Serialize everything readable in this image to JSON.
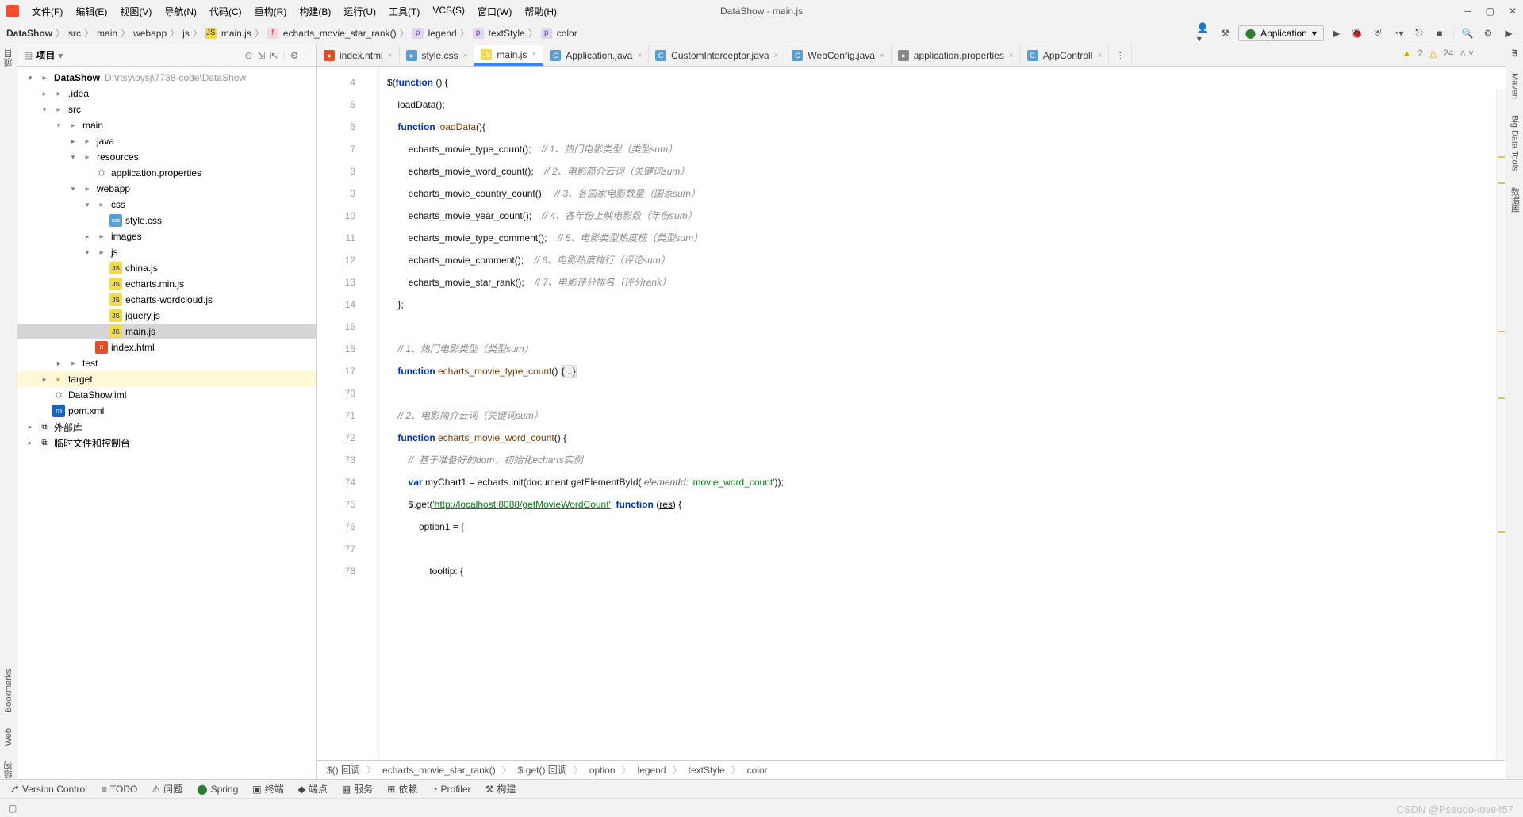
{
  "title": "DataShow - main.js",
  "menus": [
    "文件(F)",
    "编辑(E)",
    "视图(V)",
    "导航(N)",
    "代码(C)",
    "重构(R)",
    "构建(B)",
    "运行(U)",
    "工具(T)",
    "VCS(S)",
    "窗口(W)",
    "帮助(H)"
  ],
  "breadcrumb": {
    "parts": [
      "DataShow",
      "src",
      "main",
      "webapp",
      "js"
    ],
    "file": "main.js",
    "sym1": "echarts_movie_star_rank()",
    "sym2": "legend",
    "sym3": "textStyle",
    "sym4": "color"
  },
  "runconfig": "Application",
  "project": {
    "title": "项目",
    "root": {
      "name": "DataShow",
      "path": "D:\\rtsy\\bysj\\7738-code\\DataShow"
    },
    "tree": [
      {
        "indent": 0,
        "arrow": "▾",
        "icon": "folder",
        "name": "DataShow",
        "path": "D:\\rtsy\\bysj\\7738-code\\DataShow",
        "bold": true
      },
      {
        "indent": 1,
        "arrow": "▸",
        "icon": "folder",
        "name": ".idea"
      },
      {
        "indent": 1,
        "arrow": "▾",
        "icon": "folder",
        "name": "src"
      },
      {
        "indent": 2,
        "arrow": "▾",
        "icon": "folder",
        "name": "main"
      },
      {
        "indent": 3,
        "arrow": "▸",
        "icon": "folder",
        "name": "java"
      },
      {
        "indent": 3,
        "arrow": "▾",
        "icon": "folder",
        "name": "resources"
      },
      {
        "indent": 4,
        "arrow": "",
        "icon": "prop",
        "name": "application.properties"
      },
      {
        "indent": 3,
        "arrow": "▾",
        "icon": "folder",
        "name": "webapp"
      },
      {
        "indent": 4,
        "arrow": "▾",
        "icon": "folder",
        "name": "css"
      },
      {
        "indent": 5,
        "arrow": "",
        "icon": "css",
        "name": "style.css"
      },
      {
        "indent": 4,
        "arrow": "▸",
        "icon": "folder",
        "name": "images"
      },
      {
        "indent": 4,
        "arrow": "▾",
        "icon": "folder",
        "name": "js"
      },
      {
        "indent": 5,
        "arrow": "",
        "icon": "js",
        "name": "china.js"
      },
      {
        "indent": 5,
        "arrow": "",
        "icon": "js",
        "name": "echarts.min.js"
      },
      {
        "indent": 5,
        "arrow": "",
        "icon": "js",
        "name": "echarts-wordcloud.js"
      },
      {
        "indent": 5,
        "arrow": "",
        "icon": "js",
        "name": "jquery.js"
      },
      {
        "indent": 5,
        "arrow": "",
        "icon": "js",
        "name": "main.js",
        "sel": true
      },
      {
        "indent": 4,
        "arrow": "",
        "icon": "html",
        "name": "index.html"
      },
      {
        "indent": 2,
        "arrow": "▸",
        "icon": "folder",
        "name": "test"
      },
      {
        "indent": 1,
        "arrow": "▸",
        "icon": "folder-o",
        "name": "target",
        "hl": true
      },
      {
        "indent": 1,
        "arrow": "",
        "icon": "prop",
        "name": "DataShow.iml"
      },
      {
        "indent": 1,
        "arrow": "",
        "icon": "m",
        "name": "pom.xml"
      },
      {
        "indent": 0,
        "arrow": "▸",
        "icon": "lib",
        "name": "外部库"
      },
      {
        "indent": 0,
        "arrow": "▸",
        "icon": "scratch",
        "name": "临时文件和控制台"
      }
    ]
  },
  "tabs": [
    {
      "icon": "html",
      "label": "index.html"
    },
    {
      "icon": "css",
      "label": "style.css"
    },
    {
      "icon": "js",
      "label": "main.js",
      "active": true
    },
    {
      "icon": "java",
      "label": "Application.java"
    },
    {
      "icon": "java",
      "label": "CustomInterceptor.java"
    },
    {
      "icon": "java",
      "label": "WebConfig.java"
    },
    {
      "icon": "prop",
      "label": "application.properties"
    },
    {
      "icon": "java",
      "label": "AppControll"
    }
  ],
  "gutter": [
    "4",
    "5",
    "6",
    "7",
    "8",
    "9",
    "10",
    "11",
    "12",
    "13",
    "14",
    "15",
    "16",
    "17",
    "70",
    "71",
    "72",
    "73",
    "74",
    "75",
    "76",
    "77",
    "78"
  ],
  "warnings": {
    "a": "2",
    "b": "24"
  },
  "code": {
    "l4": "$(function () {",
    "l5": "    loadData();",
    "l6_kw": "    function",
    "l6_fn": " loadData",
    "l6_r": "(){",
    "l7_a": "        echarts_movie_type_count();",
    "l7_c": "    // 1、热门电影类型（类型sum）",
    "l8_a": "        echarts_movie_word_count();",
    "l8_c": "    // 2、电影简介云词（关键词sum）",
    "l9_a": "        echarts_movie_country_count();",
    "l9_c": "    // 3、各国家电影数量（国家sum）",
    "l10_a": "        echarts_movie_year_count();",
    "l10_c": "    // 4、各年份上映电影数（年份sum）",
    "l11_a": "        echarts_movie_type_comment();",
    "l11_c": "    // 5、电影类型热度榜（类型sum）",
    "l12_a": "        echarts_movie_comment();",
    "l12_c": "    // 6、电影热度排行（评论sum）",
    "l13_a": "        echarts_movie_star_rank();",
    "l13_c": "    // 7、电影评分排名（评分rank）",
    "l14": "    };",
    "l16": "    // 1、热门电影类型（类型sum）",
    "l17_kw": "    function",
    "l17_fn": " echarts_movie_type_count",
    "l17_r": "() ",
    "l17_box": "{...}",
    "l71": "    // 2、电影简介云词（关键词sum）",
    "l72_kw": "    function",
    "l72_fn": " echarts_movie_word_count",
    "l72_r": "() {",
    "l73": "        //  基于准备好的dom，初始化echarts实例",
    "l74_a": "        var",
    "l74_b": " myChart1 = echarts.init(document.getElementById(",
    "l74_p": " elementId:",
    "l74_s": " 'movie_word_count'",
    "l74_e": "));",
    "l75_a": "        $.get(",
    "l75_s": "'http://localhost:8088/getMovieWordCount'",
    "l75_b": ", ",
    "l75_kw": "function",
    "l75_c": " (",
    "l75_res": "res",
    "l75_d": ") {",
    "l76": "            option1 = {",
    "l78": "                tooltip: {"
  },
  "subcrumb": [
    "$() 回调",
    "echarts_movie_star_rank()",
    "$.get() 回调",
    "option",
    "legend",
    "textStyle",
    "color"
  ],
  "bottom": [
    "Version Control",
    "TODO",
    "问题",
    "Spring",
    "终端",
    "端点",
    "服务",
    "依赖",
    "Profiler",
    "构建"
  ],
  "leftrail": [
    "项目",
    "Bookmarks",
    "Web",
    "结构"
  ],
  "rightrail": [
    "Maven",
    "Big Data Tools",
    "数据库"
  ],
  "watermark": "CSDN @Pseudo-love457"
}
